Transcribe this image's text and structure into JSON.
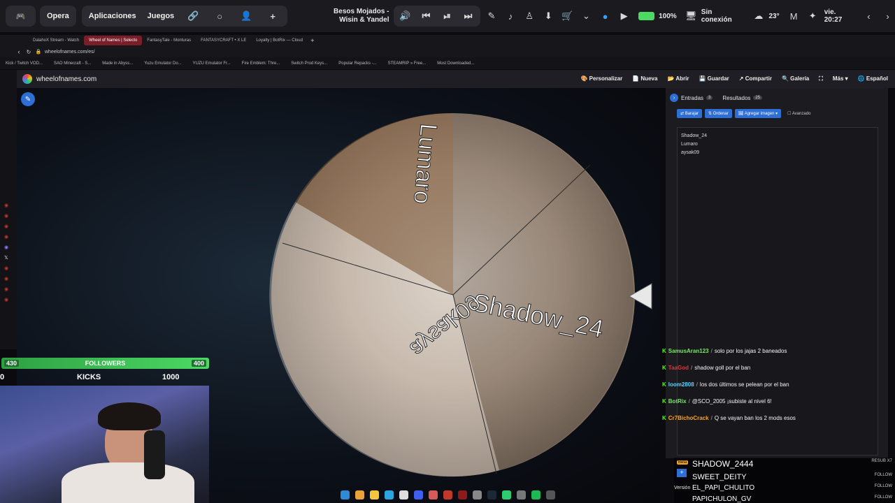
{
  "opera_bar": {
    "opera_label": "Opera",
    "apps_label": "Aplicaciones",
    "games_label": "Juegos",
    "song_title": "Besos Mojados - Wisin & Yandel",
    "battery": "100%",
    "network": "Sin conexión",
    "temperature": "23°",
    "clock": "vie. 20:27"
  },
  "browser_tabs": [
    "DalahoX Stream - Watch",
    "Wheel of Names | Selecto",
    "FantasyTale - Monturas",
    "FANTASYCRAFT • X LE",
    "Loyalty | BotRix — Cloud"
  ],
  "address": "wheelofnames.com/es/",
  "bookmarks": [
    "Kick / Twitch VOD...",
    "SAO Minecraft - S...",
    "Made in Abyss...",
    "Yuzu Emulator Do...",
    "YUZU Emulator Fr...",
    "Fire Emblem: Thre...",
    "Switch Prod Keys...",
    "Popular Repacks -...",
    "STEAMRIP » Free...",
    "Most Downloaded..."
  ],
  "site": {
    "name": "wheelofnames.com",
    "nav": [
      "Personalizar",
      "Nueva",
      "Abrir",
      "Guardar",
      "Compartir",
      "Galería",
      "Más",
      "Español"
    ]
  },
  "wheel": {
    "slices": [
      "Lumaro",
      "Shadow_24",
      "aysak09"
    ]
  },
  "panel": {
    "entries_tab": "Entradas",
    "entries_count": "3",
    "results_tab": "Resultados",
    "results_count": "25",
    "tools": [
      "Barajar",
      "Ordenar",
      "Agregar imagen"
    ],
    "advanced_label": "Avanzado",
    "entries": [
      "Shadow_24",
      "Lumaro",
      "aysak09"
    ]
  },
  "chat": [
    {
      "user": "SamusAran123",
      "color": "#7ee36b",
      "msg": "solo por los jajas 2 baneados"
    },
    {
      "user": "TaaGod",
      "color": "#e0343b",
      "msg": "shadow goll por el ban"
    },
    {
      "user": "loom2808",
      "color": "#5ad1ff",
      "msg": "los dos últimos se pelean por el ban"
    },
    {
      "user": "BotRix",
      "color": "#7ee36b",
      "msg": "@SCO_2005 ¡subiste al nivel 6!"
    },
    {
      "user": "Cr7BichoCrack",
      "color": "#f5a623",
      "msg": "Q se vayan ban los 2 mods esos"
    }
  ],
  "overlay": {
    "followers_label": "FOLLOWERS",
    "followers_current": "430",
    "followers_goal": "400",
    "kicks_left": "0",
    "kicks_label": "KICKS",
    "kicks_goal": "1000",
    "alerts": [
      "SHADOW_2444",
      "SWEET_DEITY",
      "EL_PAPI_CHULITO",
      "PAPICHULON_GV"
    ],
    "alert_types": [
      "RESUB X7",
      "FOLLOW",
      "FOLLOW",
      "FOLLOW"
    ],
    "version_label": "Versión"
  }
}
